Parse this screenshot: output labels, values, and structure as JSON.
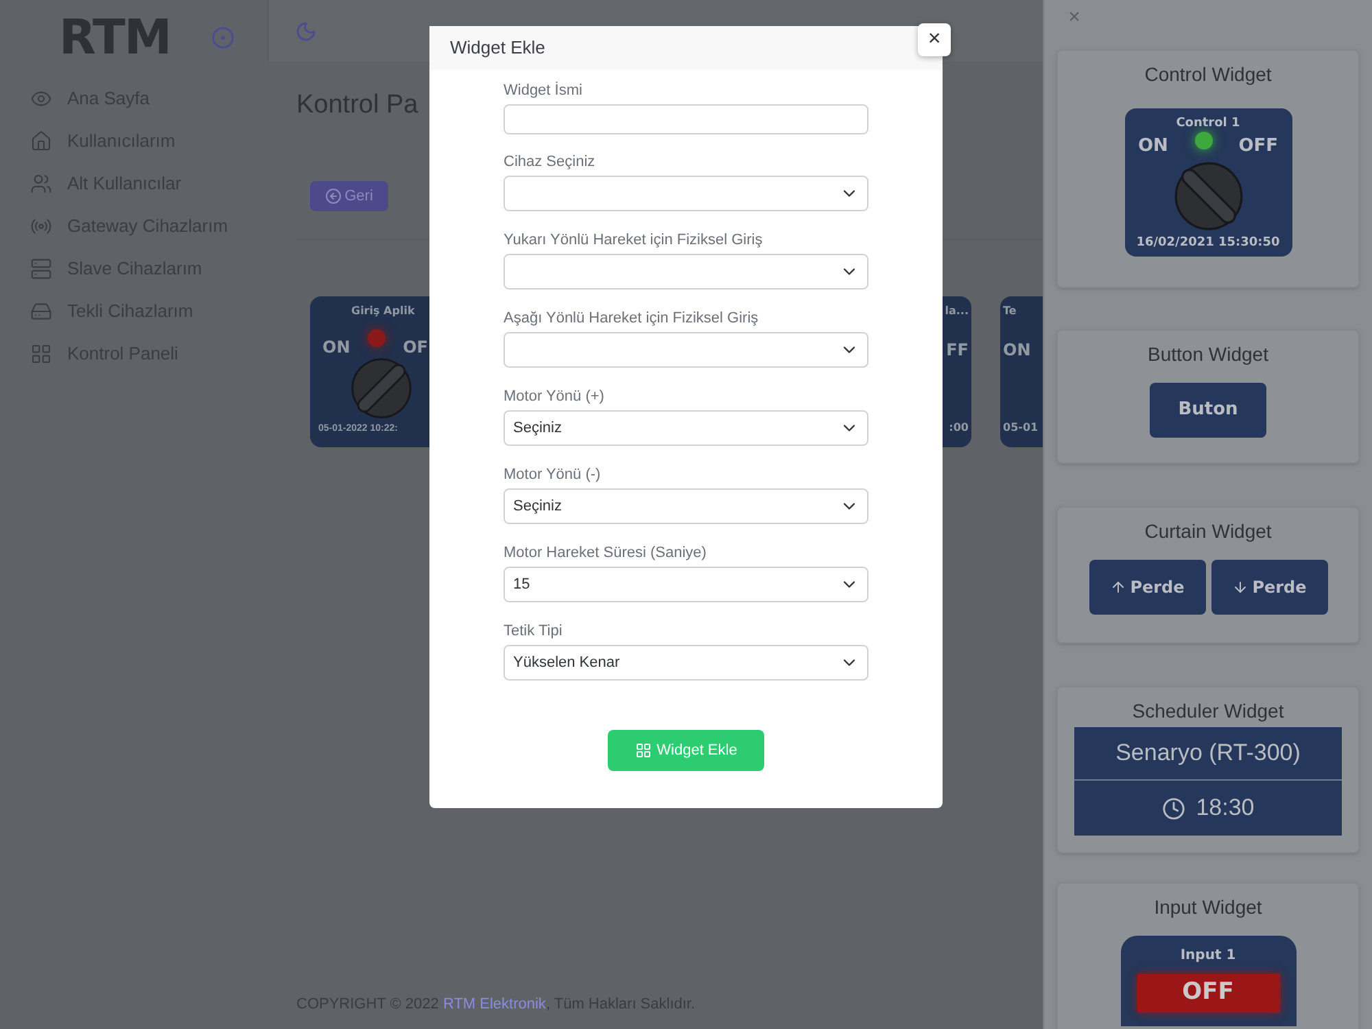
{
  "sidebar": {
    "logo": "RTM",
    "items": [
      {
        "label": "Ana Sayfa"
      },
      {
        "label": "Kullanıcılarım"
      },
      {
        "label": "Alt Kullanıcılar"
      },
      {
        "label": "Gateway Cihazlarım"
      },
      {
        "label": "Slave Cihazlarım"
      },
      {
        "label": "Tekli Cihazlarım"
      },
      {
        "label": "Kontrol Paneli"
      }
    ]
  },
  "page": {
    "title": "Kontrol Pa",
    "back_button": "Geri",
    "widget": {
      "title": "Giriş Aplik",
      "on_label": "ON",
      "off_label": "OF",
      "timestamp": "05-01-2022 10:22:",
      "on": false
    },
    "fragments": [
      {
        "title": "la...",
        "label": "FF",
        "timestamp": ":00"
      },
      {
        "title": "Te",
        "label": "ON",
        "timestamp": "05-01"
      }
    ],
    "footer": {
      "prefix": "COPYRIGHT © 2022 ",
      "link": "RTM Elektronik",
      "suffix": ", Tüm Hakları Saklıdır."
    }
  },
  "modal": {
    "title": "Widget Ekle",
    "close": "×",
    "fields": [
      {
        "label": "Widget İsmi",
        "kind": "text"
      },
      {
        "label": "Cihaz Seçiniz",
        "kind": "select"
      },
      {
        "label": "Yukarı Yönlü Hareket için Fiziksel Giriş",
        "kind": "select"
      },
      {
        "label": "Aşağı Yönlü Hareket için Fiziksel Giriş",
        "kind": "select"
      },
      {
        "label": "Motor Yönü (+)",
        "kind": "select",
        "value": "Seçiniz"
      },
      {
        "label": "Motor Yönü (-)",
        "kind": "select",
        "value": "Seçiniz"
      },
      {
        "label": "Motor Hareket Süresi (Saniye)",
        "kind": "select",
        "value": "15"
      },
      {
        "label": "Tetik Tipi",
        "kind": "select",
        "value": "Yükselen Kenar"
      }
    ],
    "submit": "Widget Ekle"
  },
  "drawer": {
    "close": "×",
    "widgets": [
      {
        "kind": "control",
        "title": "Control Widget",
        "name": "Control 1",
        "on_label": "ON",
        "off_label": "OFF",
        "timestamp": "16/02/2021 15:30:50",
        "on": true
      },
      {
        "kind": "button",
        "title": "Button Widget",
        "label": "Buton"
      },
      {
        "kind": "curtain",
        "title": "Curtain Widget",
        "buttons": [
          {
            "label": "Perde"
          },
          {
            "label": "Perde"
          }
        ]
      },
      {
        "kind": "scheduler",
        "title": "Scheduler Widget",
        "scenario": "Senaryo (RT-300)",
        "time": "18:30"
      },
      {
        "kind": "input",
        "title": "Input Widget",
        "name": "Input 1",
        "state": "OFF"
      }
    ]
  }
}
